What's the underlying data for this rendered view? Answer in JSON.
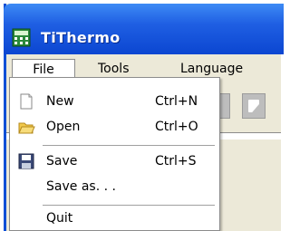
{
  "window": {
    "title": "TiThermo",
    "icon": "calculator-icon"
  },
  "menubar": {
    "items": [
      "File",
      "Tools",
      "Language"
    ]
  },
  "file_menu": {
    "items": [
      {
        "label": "New",
        "shortcut": "Ctrl+N",
        "icon": "new-document-icon"
      },
      {
        "label": "Open",
        "shortcut": "Ctrl+O",
        "icon": "open-folder-icon"
      },
      {
        "label": "Save",
        "shortcut": "Ctrl+S",
        "icon": "save-disk-icon"
      },
      {
        "label": "Save as. . .",
        "shortcut": "",
        "icon": ""
      },
      {
        "label": "Quit",
        "shortcut": "",
        "icon": ""
      }
    ]
  },
  "colors": {
    "titlebar": "#1f5fe3",
    "menu_bg": "#ffffff",
    "window_bg": "#ece9d8"
  }
}
